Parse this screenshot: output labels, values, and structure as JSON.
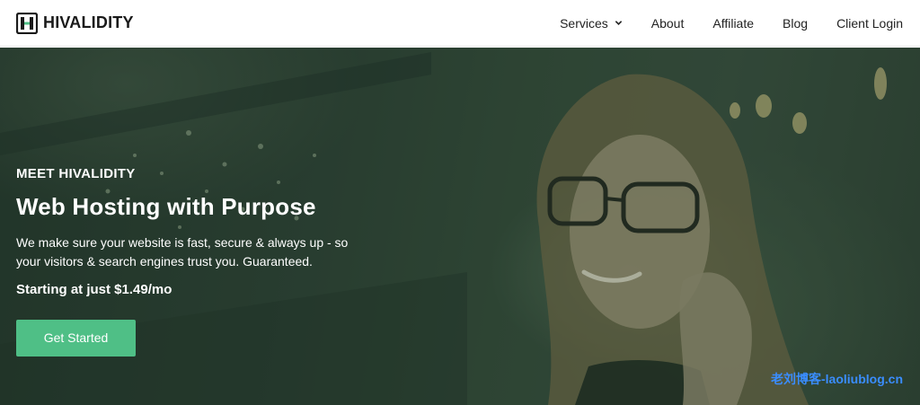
{
  "header": {
    "brand": "HIVALIDITY",
    "nav": {
      "services": "Services",
      "about": "About",
      "affiliate": "Affiliate",
      "blog": "Blog",
      "client_login": "Client Login"
    }
  },
  "hero": {
    "eyebrow": "MEET HIVALIDITY",
    "headline": "Web Hosting with Purpose",
    "tagline": "We make sure your website is fast, secure & always up - so your visitors & search engines trust you. Guaranteed.",
    "price": "Starting at just $1.49/mo",
    "cta_label": "Get Started"
  },
  "watermark": "老刘博客-laoliublog.cn",
  "colors": {
    "cta": "#4fbf86",
    "overlay": "#2f4434",
    "brand_dark": "#1a1a1a",
    "logo_green": "#4fbf86"
  },
  "icons": [
    "hivalidity-logo-icon",
    "chevron-down-icon"
  ]
}
